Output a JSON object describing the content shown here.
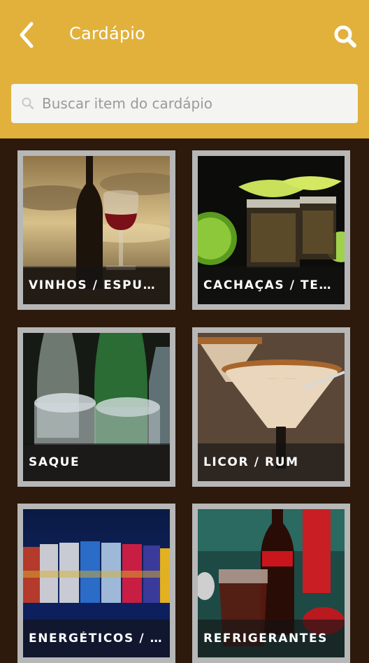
{
  "header": {
    "title": "Cardápio",
    "back_icon": "chevron-left-icon",
    "search_icon": "search-icon",
    "background_color": "#e1b13c"
  },
  "search": {
    "placeholder": "Buscar item do cardápio",
    "value": ""
  },
  "background_color": "#2d1a0c",
  "categories": [
    {
      "label": "VINHOS / ESPUM...",
      "image": "wine-bottle-and-glass-photo"
    },
    {
      "label": "CACHAÇAS / TEQ...",
      "image": "tequila-shots-with-lime-photo"
    },
    {
      "label": "SAQUE",
      "image": "sake-glasses-photo"
    },
    {
      "label": "LICOR / RUM",
      "image": "cream-liqueur-cocktail-photo"
    },
    {
      "label": "ENERGÉTICOS / I...",
      "image": "energy-drink-cans-photo"
    },
    {
      "label": "REFRIGERANTES",
      "image": "cola-bottle-and-glass-photo"
    }
  ]
}
